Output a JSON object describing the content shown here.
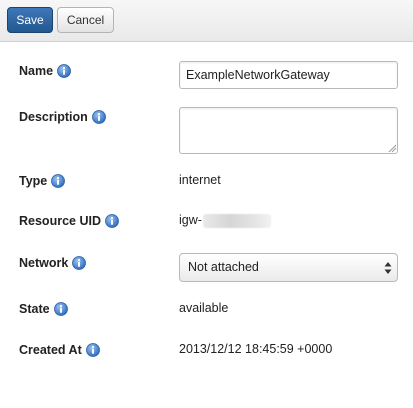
{
  "toolbar": {
    "save_label": "Save",
    "cancel_label": "Cancel"
  },
  "form": {
    "name": {
      "label": "Name",
      "value": "ExampleNetworkGateway"
    },
    "description": {
      "label": "Description",
      "value": ""
    },
    "type": {
      "label": "Type",
      "value": "internet"
    },
    "resource_uid": {
      "label": "Resource UID",
      "value_prefix": "igw-"
    },
    "network": {
      "label": "Network",
      "selected": "Not attached"
    },
    "state": {
      "label": "State",
      "value": "available"
    },
    "created_at": {
      "label": "Created At",
      "value": "2013/12/12 18:45:59 +0000"
    }
  },
  "icons": {
    "info": "info-icon",
    "select_arrows": "up-down-arrows-icon",
    "resize": "resize-grip-icon"
  },
  "colors": {
    "primary_button": "#2b62a0",
    "info_icon": "#3f7fd0"
  }
}
